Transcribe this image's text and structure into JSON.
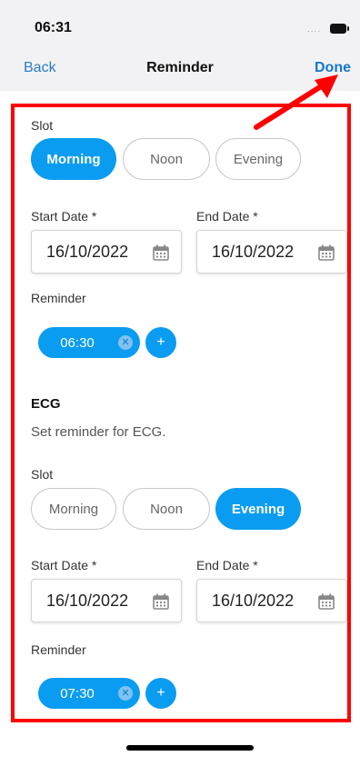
{
  "status_bar": {
    "time": "06:31",
    "signal": "....",
    "battery": "battery-icon"
  },
  "nav": {
    "back_label": "Back",
    "title": "Reminder",
    "done_label": "Done"
  },
  "first_reminder": {
    "slot_label": "Slot",
    "slots": [
      "Morning",
      "Noon",
      "Evening"
    ],
    "selected_slot": "Morning",
    "start_date_label": "Start Date *",
    "start_date": "16/10/2022",
    "end_date_label": "End Date *",
    "end_date": "16/10/2022",
    "reminder_label": "Reminder",
    "times": [
      "06:30"
    ],
    "add_label": "+"
  },
  "ecg": {
    "title": "ECG",
    "subtitle": "Set reminder for ECG.",
    "slot_label": "Slot",
    "slots": [
      "Morning",
      "Noon",
      "Evening"
    ],
    "selected_slot": "Evening",
    "start_date_label": "Start Date *",
    "start_date": "16/10/2022",
    "end_date_label": "End Date *",
    "end_date": "16/10/2022",
    "reminder_label": "Reminder",
    "times": [
      "07:30"
    ],
    "add_label": "+"
  },
  "colors": {
    "accent": "#0a9cf0",
    "nav_link": "#2b7bc6",
    "annotation": "#ff0000"
  },
  "icons": {
    "calendar": "calendar-icon",
    "clear": "clear-icon"
  }
}
